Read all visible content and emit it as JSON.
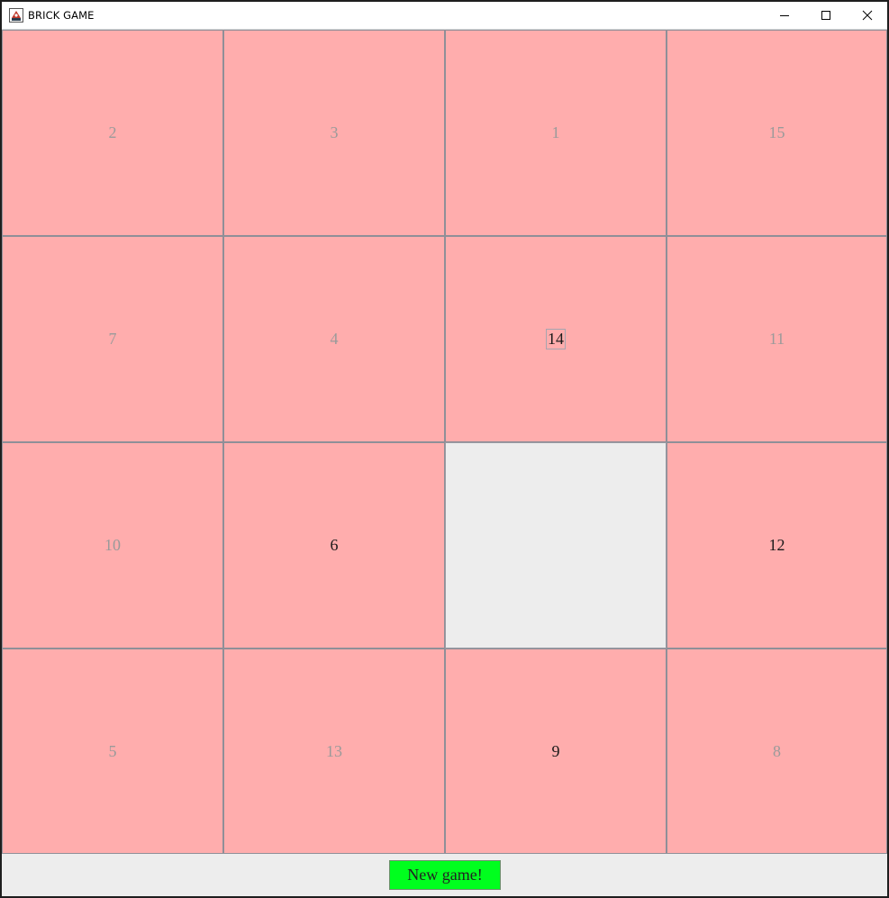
{
  "window": {
    "title": "BRICK GAME"
  },
  "board": {
    "tiles": [
      {
        "label": "2",
        "state": "normal"
      },
      {
        "label": "3",
        "state": "normal"
      },
      {
        "label": "1",
        "state": "normal"
      },
      {
        "label": "15",
        "state": "normal"
      },
      {
        "label": "7",
        "state": "normal"
      },
      {
        "label": "4",
        "state": "normal"
      },
      {
        "label": "14",
        "state": "focused"
      },
      {
        "label": "11",
        "state": "normal"
      },
      {
        "label": "10",
        "state": "normal"
      },
      {
        "label": "6",
        "state": "movable"
      },
      {
        "label": "",
        "state": "empty"
      },
      {
        "label": "12",
        "state": "movable"
      },
      {
        "label": "5",
        "state": "normal"
      },
      {
        "label": "13",
        "state": "normal"
      },
      {
        "label": "9",
        "state": "movable"
      },
      {
        "label": "8",
        "state": "normal"
      }
    ]
  },
  "footer": {
    "new_game_label": "New game!"
  },
  "colors": {
    "tile_background": "#ffadad",
    "empty_background": "#ededed",
    "new_game_button": "#00ff1e",
    "disabled_text": "#9a9a9a",
    "active_text": "#1a1a1a"
  }
}
